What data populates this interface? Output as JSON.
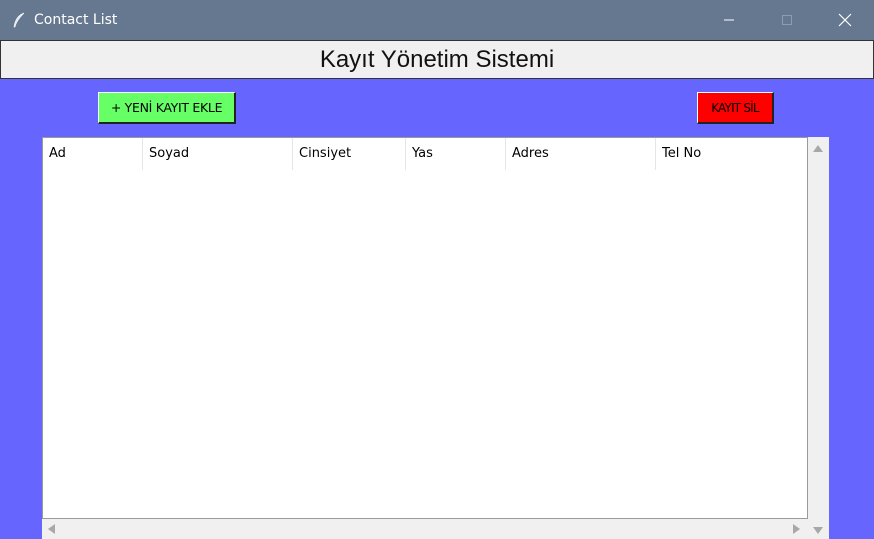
{
  "window": {
    "title": "Contact List",
    "app_icon": "feather-icon",
    "controls": [
      "minimize-icon",
      "maximize-icon",
      "close-icon"
    ]
  },
  "header": {
    "title": "Kayıt Yönetim Sistemi"
  },
  "toolbar": {
    "add_label": "+ YENİ KAYIT EKLE",
    "delete_label": "KAYIT SİL"
  },
  "table": {
    "columns": [
      "Ad",
      "Soyad",
      "Cinsiyet",
      "Yas",
      "Adres",
      "Tel No"
    ],
    "rows": []
  },
  "colors": {
    "background": "#6666ff",
    "titlebar": "#66788f",
    "add_button": "#66ff66",
    "delete_button": "#ff0000"
  }
}
